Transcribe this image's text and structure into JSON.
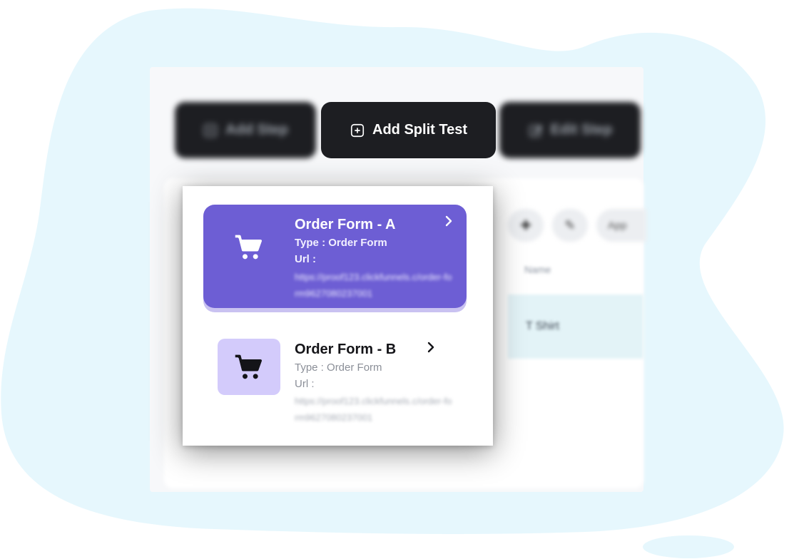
{
  "colors": {
    "blob": "#e6f7fd",
    "button_dark": "#1d1e22",
    "card_active": "#6d5ed4",
    "card_inactive_icon_bg": "#d3cbfb"
  },
  "toolbar": {
    "add_step_label": "Add Step",
    "add_split_test_label": "Add Split Test",
    "edit_step_label": "Edit Step"
  },
  "background_table": {
    "action_label": "App",
    "column_header": "Name",
    "row_value": "T Shirt"
  },
  "split_test_menu": {
    "items": [
      {
        "title": "Order Form - A",
        "type_text": "Type : Order Form",
        "url_label": "Url :",
        "url_value": "https://proof123.clickfunnels.c/order-form9627080237001",
        "icon": "shopping-cart-icon",
        "active": true
      },
      {
        "title": "Order Form - B",
        "type_text": "Type : Order Form",
        "url_label": "Url :",
        "url_value": "https://proof123.clickfunnels.c/order-form9627080237001",
        "icon": "shopping-cart-icon",
        "active": false
      }
    ]
  }
}
